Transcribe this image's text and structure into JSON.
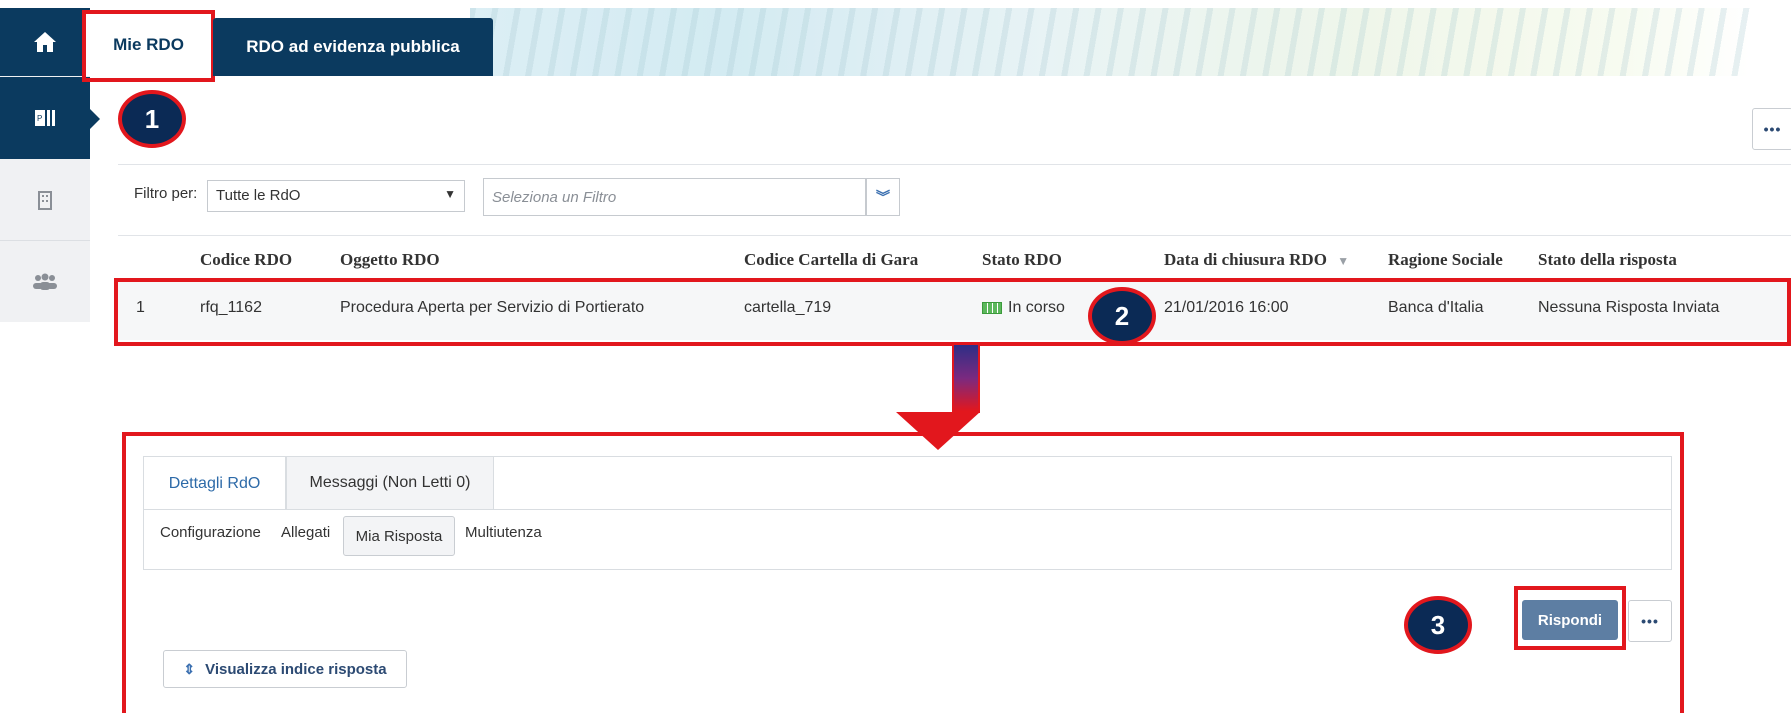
{
  "top_tabs": {
    "mie_rdo": "Mie RDO",
    "rdo_evidenza": "RDO ad evidenza pubblica"
  },
  "more_label": "•••",
  "filter": {
    "label": "Filtro per:",
    "selected": "Tutte le RdO",
    "placeholder": "Seleziona un Filtro"
  },
  "table": {
    "columns": [
      "Codice RDO",
      "Oggetto RDO",
      "Codice Cartella di Gara",
      "Stato RDO",
      "Data di chiusura RDO",
      "Ragione Sociale",
      "Stato della risposta"
    ],
    "rows": [
      {
        "index": "1",
        "codice": "rfq_1162",
        "oggetto": "Procedura Aperta per Servizio di Portierato",
        "cartella": "cartella_719",
        "stato": "In corso",
        "data": "21/01/2016 16:00",
        "ragione": "Banca d'Italia",
        "risposta": "Nessuna Risposta Inviata"
      }
    ]
  },
  "detail": {
    "tabs": [
      "Dettagli RdO",
      "Messaggi (Non Letti 0)"
    ],
    "subtabs": [
      "Configurazione",
      "Allegati",
      "Mia Risposta",
      "Multiutenza"
    ],
    "rispondi_label": "Rispondi",
    "visualizza_label": "Visualizza indice risposta"
  },
  "callouts": [
    "1",
    "2",
    "3"
  ],
  "colors": {
    "navy": "#0b3a5f",
    "highlight_red": "#e2171d",
    "rispondi_blue": "#5d7ea3"
  }
}
